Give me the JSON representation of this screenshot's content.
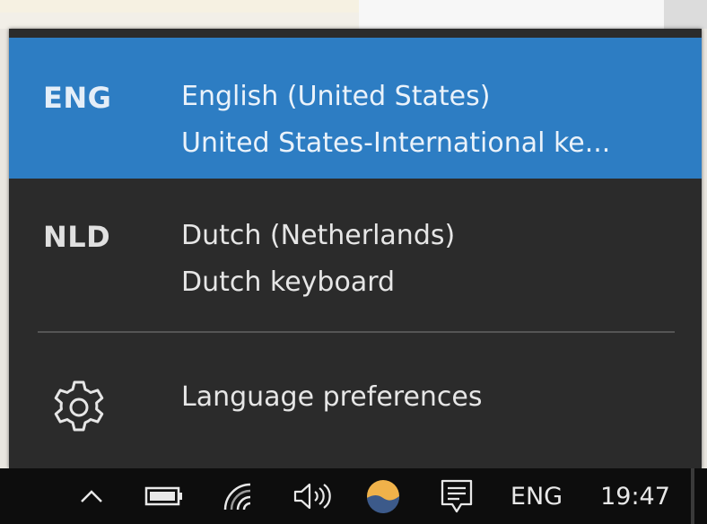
{
  "flyout": {
    "languages": [
      {
        "code": "ENG",
        "name": "English (United States)",
        "layout": "United States-International ke...",
        "selected": true
      },
      {
        "code": "NLD",
        "name": "Dutch (Netherlands)",
        "layout": "Dutch keyboard",
        "selected": false
      }
    ],
    "preferences_label": "Language preferences",
    "preferences_icon": "gear-icon"
  },
  "taskbar": {
    "icons": [
      "chevron-up-icon",
      "battery-icon",
      "wifi-icon",
      "volume-icon",
      "weather-icon",
      "notification-icon"
    ],
    "language": "ENG",
    "time": "19:47"
  },
  "colors": {
    "selected_bg": "#2d7dc3",
    "flyout_bg": "#2b2b2b",
    "taskbar_bg": "#0d0d0d"
  }
}
